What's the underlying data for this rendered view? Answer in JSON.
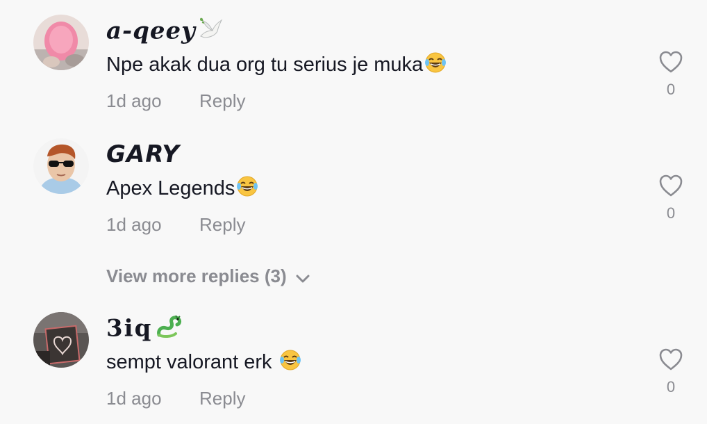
{
  "comments": [
    {
      "username": "a-qeey",
      "text": "Npe akak dua org tu serius je muka",
      "time": "1d ago",
      "reply_label": "Reply",
      "likes": "0",
      "name_emoji_icon": "dove-icon",
      "text_emoji_icon": "laughing-tears-emoji-icon"
    },
    {
      "username": "GARY",
      "text": "Apex Legends",
      "time": "1d ago",
      "reply_label": "Reply",
      "likes": "0",
      "text_emoji_icon": "laughing-tears-emoji-icon"
    },
    {
      "username": "3iq",
      "text": "sempt valorant erk ",
      "time": "1d ago",
      "reply_label": "Reply",
      "likes": "0",
      "name_emoji_icon": "dragon-icon",
      "text_emoji_icon": "laughing-tears-emoji-icon"
    }
  ],
  "view_more_replies": "View more replies (3)",
  "colors": {
    "background": "#f8f8f8",
    "text": "#161823",
    "muted": "#8a8b91"
  }
}
